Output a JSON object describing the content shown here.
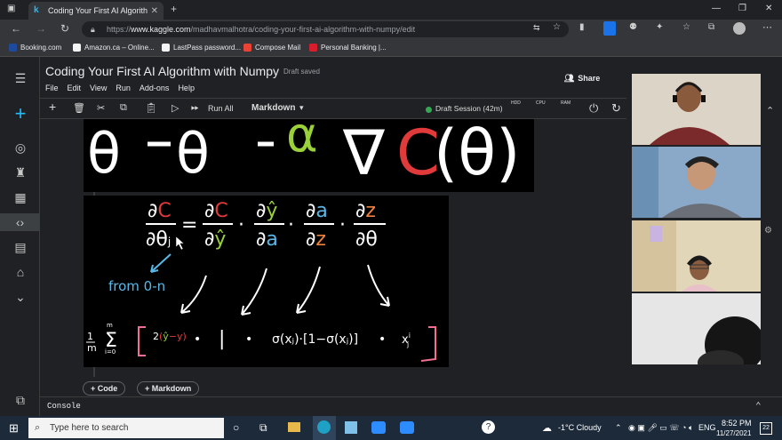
{
  "browser": {
    "tab_title": "Coding Your First AI Algorithm w",
    "url_prefix": "https://",
    "url_host": "www.kaggle.com",
    "url_path": "/madhavmalhotra/coding-your-first-ai-algorithm-with-numpy/edit",
    "bookmarks": [
      {
        "label": "Booking.com",
        "color": "#1e4a9e"
      },
      {
        "label": "Amazon.ca – Online...",
        "color": "#f5f5f5"
      },
      {
        "label": "LastPass password...",
        "color": "#f5f5f5"
      },
      {
        "label": "Compose Mail",
        "color": "#ea4335"
      },
      {
        "label": "Personal Banking |...",
        "color": "#d81e2c"
      }
    ]
  },
  "notebook": {
    "title": "Coding Your First AI Algorithm with Numpy",
    "status": "Draft saved",
    "menu": [
      "File",
      "Edit",
      "View",
      "Run",
      "Add-ons",
      "Help"
    ],
    "share_label": "Share",
    "run_all_label": "Run All",
    "cell_type": "Markdown",
    "session": "Draft Session (42m)",
    "meters": [
      "HDD",
      "CPU",
      "RAM"
    ],
    "add_code": "Code",
    "add_markdown": "Markdown",
    "console_label": "Console"
  },
  "formula": {
    "top_text": "θ = θ − α ∇C(θ)",
    "annotation": "from 0-n",
    "chain_lhs": "∂C / ∂θj",
    "chain_terms": [
      "∂C / ∂ŷ",
      "∂ŷ / ∂a",
      "∂a / ∂z",
      "∂z / ∂θ"
    ],
    "sum_prefix": "1/m Σ (i=0 to m)",
    "bottom_terms": [
      "2(ŷ−y)",
      "1",
      "σ(xᵢ)·[1−σ(xᵢ)]",
      "xʲᵢ"
    ]
  },
  "taskbar": {
    "search_placeholder": "Type here to search",
    "weather": "-1°C  Cloudy",
    "lang": "ENG",
    "time": "8:52 PM",
    "date": "11/27/2021",
    "notif_count": "22"
  },
  "colors": {
    "accent": "#20beff",
    "session_dot": "#34a853",
    "red": "#e03a3a",
    "green": "#9ad03a",
    "orange": "#f0803a",
    "blue": "#5ab8e8",
    "pink": "#f07090"
  }
}
